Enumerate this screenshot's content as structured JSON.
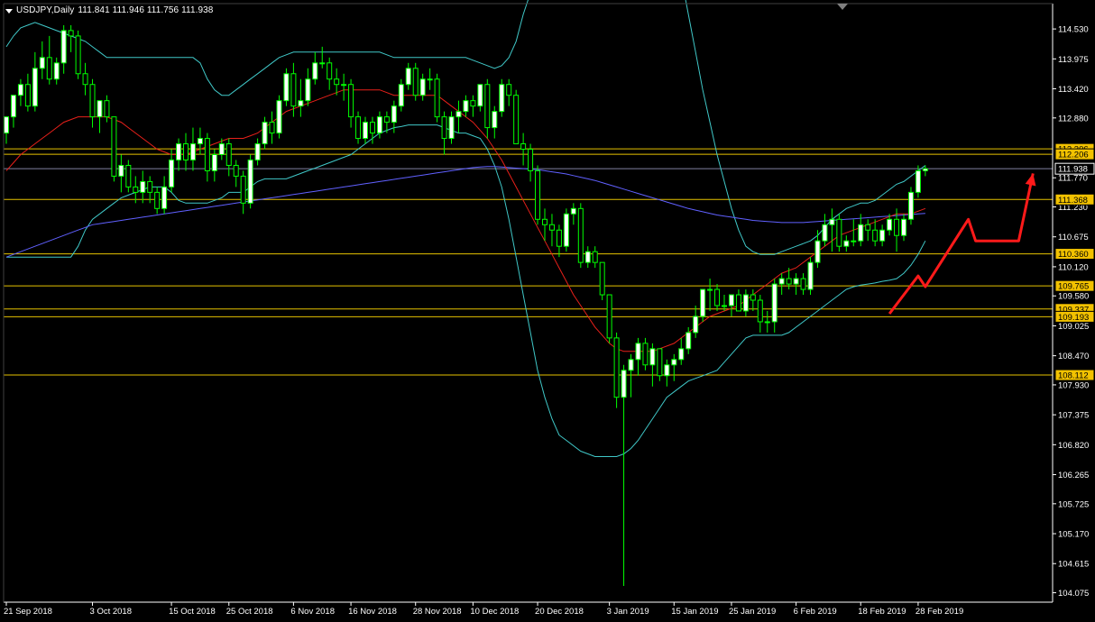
{
  "header": {
    "symbol": "USDJPY,Daily",
    "quote": "111.841 111.946 111.756 111.938"
  },
  "colors": {
    "background": "#000000",
    "axis": "#ffffff",
    "bull_candle": "#ffffff",
    "candle_outline": "#00ff00",
    "bollinger_band": "#40c8c8",
    "ma_fast": "#e8201a",
    "ma_slow": "#6060ff",
    "level_line": "#e6c200",
    "level_label_bg": "#f2c200",
    "current_price_bg": "#000000",
    "arrow": "#ff1a1a"
  },
  "chart_data": {
    "type": "candlestick",
    "title": "USDJPY,Daily",
    "ylim": [
      103.9,
      115.0
    ],
    "y_ticks": [
      "114.530",
      "113.975",
      "113.420",
      "112.880",
      "111.770",
      "111.230",
      "110.675",
      "110.120",
      "109.580",
      "109.025",
      "108.470",
      "107.930",
      "107.375",
      "106.820",
      "106.265",
      "105.725",
      "105.170",
      "104.615",
      "104.075"
    ],
    "x_ticks": [
      "21 Sep 2018",
      "3 Oct 2018",
      "15 Oct 2018",
      "25 Oct 2018",
      "6 Nov 2018",
      "16 Nov 2018",
      "28 Nov 2018",
      "10 Dec 2018",
      "20 Dec 2018",
      "3 Jan 2019",
      "15 Jan 2019",
      "25 Jan 2019",
      "6 Feb 2019",
      "18 Feb 2019",
      "28 Feb 2019"
    ],
    "x_tick_index": [
      0,
      12,
      23,
      31,
      40,
      48,
      57,
      65,
      74,
      84,
      93,
      101,
      110,
      119,
      127
    ],
    "levels": [
      "112.306",
      "112.206",
      "111.368",
      "110.360",
      "109.765",
      "109.337",
      "109.193",
      "108.112"
    ],
    "current_price": "111.938",
    "candles": {
      "open": [
        112.6,
        112.9,
        113.3,
        113.5,
        113.1,
        113.8,
        114.0,
        113.6,
        113.9,
        114.5,
        114.4,
        113.7,
        113.5,
        112.9,
        113.2,
        112.9,
        111.8,
        112.0,
        111.6,
        111.5,
        111.7,
        111.5,
        111.2,
        111.6,
        112.1,
        112.4,
        112.1,
        112.4,
        112.5,
        111.9,
        112.2,
        112.4,
        112.0,
        111.8,
        111.3,
        112.1,
        112.4,
        112.8,
        112.6,
        113.2,
        113.7,
        113.1,
        113.2,
        113.6,
        113.9,
        113.9,
        113.6,
        113.5,
        113.5,
        112.9,
        112.5,
        112.8,
        112.6,
        112.9,
        112.8,
        113.1,
        113.5,
        113.8,
        113.3,
        113.6,
        113.6,
        112.9,
        112.5,
        112.9,
        113.0,
        113.2,
        113.1,
        113.5,
        112.7,
        113.0,
        113.5,
        113.3,
        112.4,
        112.3,
        111.9,
        111.0,
        110.9,
        110.8,
        110.5,
        111.1,
        111.2,
        110.2,
        110.4,
        110.2,
        109.6,
        108.8,
        107.7,
        108.2,
        108.4,
        108.7,
        108.3,
        108.6,
        108.1,
        108.3,
        108.4,
        108.6,
        108.9,
        109.2,
        109.7,
        109.7,
        109.4,
        109.4,
        109.6,
        109.3,
        109.6,
        109.5,
        109.1,
        109.1,
        109.8,
        109.9,
        109.8,
        109.9,
        109.7,
        110.2,
        110.6,
        110.9,
        111.0,
        110.5,
        110.6,
        110.6,
        110.9,
        110.8,
        110.6,
        110.8,
        111.0,
        110.7,
        111.0,
        111.5,
        111.9
      ],
      "high": [
        112.9,
        113.3,
        113.6,
        113.7,
        114.1,
        114.3,
        114.4,
        114.0,
        114.6,
        114.6,
        114.5,
        113.9,
        113.6,
        113.1,
        113.3,
        112.9,
        112.2,
        112.1,
        111.8,
        111.9,
        111.8,
        111.6,
        111.8,
        112.3,
        112.5,
        112.6,
        112.7,
        112.7,
        112.6,
        112.3,
        112.5,
        112.5,
        112.1,
        111.9,
        112.2,
        112.5,
        112.9,
        113.0,
        113.3,
        113.8,
        113.9,
        113.6,
        113.8,
        114.1,
        114.2,
        114.0,
        113.8,
        113.7,
        113.6,
        113.0,
        112.9,
        112.9,
        113.0,
        113.0,
        113.2,
        113.6,
        113.9,
        113.9,
        113.7,
        113.8,
        113.7,
        113.0,
        113.0,
        113.2,
        113.3,
        113.3,
        113.5,
        113.6,
        113.1,
        113.6,
        113.6,
        113.4,
        112.6,
        112.4,
        112.0,
        111.2,
        111.1,
        110.9,
        111.2,
        111.3,
        111.3,
        110.5,
        110.5,
        110.2,
        109.6,
        108.9,
        108.3,
        108.5,
        108.8,
        108.8,
        108.7,
        108.6,
        108.4,
        108.5,
        108.8,
        109.0,
        109.4,
        109.7,
        109.9,
        109.8,
        109.6,
        109.6,
        109.7,
        109.7,
        109.7,
        109.6,
        109.3,
        109.9,
        110.0,
        110.1,
        110.0,
        110.0,
        110.3,
        110.8,
        111.1,
        111.2,
        111.1,
        110.7,
        111.0,
        111.1,
        111.0,
        111.0,
        110.9,
        111.1,
        111.2,
        111.1,
        111.6,
        112.0,
        112.0
      ],
      "low": [
        112.4,
        112.7,
        113.1,
        113.0,
        113.0,
        113.6,
        113.5,
        113.5,
        113.7,
        114.1,
        113.6,
        113.3,
        112.7,
        112.6,
        112.8,
        111.7,
        111.5,
        111.5,
        111.3,
        111.3,
        111.3,
        111.1,
        111.1,
        111.5,
        111.9,
        111.9,
        111.9,
        112.2,
        111.7,
        111.7,
        112.1,
        111.8,
        111.6,
        111.1,
        111.2,
        112.0,
        112.3,
        112.4,
        112.5,
        113.1,
        112.9,
        112.9,
        113.1,
        113.5,
        113.8,
        113.4,
        113.3,
        113.2,
        112.7,
        112.4,
        112.4,
        112.4,
        112.5,
        112.6,
        112.6,
        113.0,
        113.4,
        113.2,
        113.2,
        113.4,
        112.8,
        112.2,
        112.4,
        112.6,
        112.9,
        112.9,
        113.0,
        112.5,
        112.5,
        112.9,
        113.1,
        112.4,
        112.0,
        111.7,
        110.9,
        110.6,
        110.5,
        110.3,
        110.4,
        110.9,
        110.1,
        110.1,
        110.1,
        109.5,
        108.7,
        107.5,
        104.2,
        107.7,
        108.1,
        108.2,
        107.9,
        108.0,
        107.9,
        108.0,
        108.3,
        108.5,
        108.8,
        109.1,
        109.3,
        109.3,
        109.3,
        109.2,
        109.3,
        109.2,
        109.3,
        108.9,
        108.9,
        108.9,
        109.6,
        109.7,
        109.6,
        109.6,
        109.6,
        110.1,
        110.5,
        110.4,
        110.4,
        110.4,
        110.5,
        110.5,
        110.6,
        110.5,
        110.5,
        110.7,
        110.4,
        110.6,
        110.9,
        111.4,
        111.8
      ],
      "close": [
        112.9,
        113.3,
        113.5,
        113.1,
        113.8,
        114.0,
        113.6,
        113.9,
        114.5,
        114.4,
        113.7,
        113.5,
        112.9,
        113.2,
        112.9,
        111.8,
        112.0,
        111.6,
        111.5,
        111.7,
        111.5,
        111.2,
        111.6,
        112.1,
        112.4,
        112.1,
        112.4,
        112.5,
        111.9,
        112.2,
        112.4,
        112.0,
        111.8,
        111.3,
        112.1,
        112.4,
        112.8,
        112.6,
        113.2,
        113.7,
        113.1,
        113.2,
        113.6,
        113.9,
        113.9,
        113.6,
        113.5,
        113.5,
        112.9,
        112.5,
        112.8,
        112.6,
        112.9,
        112.8,
        113.1,
        113.5,
        113.8,
        113.3,
        113.6,
        113.6,
        112.9,
        112.5,
        112.9,
        113.0,
        113.2,
        113.1,
        113.5,
        112.7,
        113.0,
        113.5,
        113.3,
        112.4,
        112.3,
        111.9,
        111.0,
        110.9,
        110.8,
        110.5,
        111.1,
        111.2,
        110.2,
        110.4,
        110.2,
        109.6,
        108.8,
        107.7,
        108.2,
        108.4,
        108.7,
        108.3,
        108.6,
        108.1,
        108.3,
        108.4,
        108.6,
        108.9,
        109.2,
        109.7,
        109.7,
        109.4,
        109.4,
        109.6,
        109.3,
        109.6,
        109.5,
        109.1,
        109.1,
        109.8,
        109.9,
        109.8,
        109.9,
        109.7,
        110.2,
        110.6,
        110.9,
        111.0,
        110.5,
        110.6,
        110.6,
        110.9,
        110.8,
        110.6,
        110.8,
        111.0,
        110.7,
        111.0,
        111.5,
        111.9,
        111.938
      ]
    },
    "ma_fast": [
      111.9,
      112.05,
      112.2,
      112.3,
      112.4,
      112.5,
      112.6,
      112.7,
      112.8,
      112.85,
      112.9,
      112.9,
      112.9,
      112.9,
      112.9,
      112.85,
      112.8,
      112.7,
      112.6,
      112.5,
      112.4,
      112.3,
      112.25,
      112.2,
      112.2,
      112.2,
      112.25,
      112.3,
      112.35,
      112.4,
      112.45,
      112.5,
      112.5,
      112.5,
      112.55,
      112.6,
      112.7,
      112.8,
      112.9,
      113.0,
      113.05,
      113.1,
      113.15,
      113.2,
      113.25,
      113.3,
      113.35,
      113.4,
      113.4,
      113.4,
      113.4,
      113.4,
      113.4,
      113.35,
      113.3,
      113.3,
      113.3,
      113.3,
      113.3,
      113.3,
      113.3,
      113.2,
      113.1,
      113.0,
      112.9,
      112.8,
      112.65,
      112.5,
      112.3,
      112.1,
      111.85,
      111.6,
      111.35,
      111.1,
      110.85,
      110.6,
      110.35,
      110.1,
      109.85,
      109.6,
      109.4,
      109.2,
      109.0,
      108.85,
      108.7,
      108.6,
      108.55,
      108.55,
      108.55,
      108.55,
      108.55,
      108.6,
      108.65,
      108.7,
      108.8,
      108.9,
      109.0,
      109.1,
      109.2,
      109.25,
      109.3,
      109.35,
      109.4,
      109.5,
      109.6,
      109.7,
      109.8,
      109.9,
      110.0,
      110.05,
      110.1,
      110.2,
      110.3,
      110.4,
      110.5,
      110.6,
      110.7,
      110.75,
      110.8,
      110.85,
      110.9,
      110.95,
      111.0,
      111.05,
      111.1,
      111.1,
      111.1,
      111.15,
      111.2
    ],
    "ma_slow": [
      110.3,
      110.35,
      110.4,
      110.45,
      110.5,
      110.55,
      110.6,
      110.65,
      110.7,
      110.75,
      110.8,
      110.85,
      110.9,
      110.92,
      110.94,
      110.96,
      110.98,
      111.0,
      111.02,
      111.04,
      111.06,
      111.08,
      111.1,
      111.12,
      111.14,
      111.16,
      111.18,
      111.2,
      111.22,
      111.24,
      111.26,
      111.28,
      111.3,
      111.32,
      111.34,
      111.36,
      111.38,
      111.4,
      111.42,
      111.44,
      111.46,
      111.48,
      111.5,
      111.52,
      111.54,
      111.56,
      111.58,
      111.6,
      111.62,
      111.64,
      111.66,
      111.68,
      111.7,
      111.72,
      111.74,
      111.76,
      111.78,
      111.8,
      111.82,
      111.84,
      111.86,
      111.88,
      111.9,
      111.92,
      111.94,
      111.96,
      111.97,
      111.98,
      111.98,
      111.97,
      111.96,
      111.95,
      111.94,
      111.93,
      111.92,
      111.9,
      111.88,
      111.86,
      111.84,
      111.81,
      111.78,
      111.75,
      111.72,
      111.68,
      111.64,
      111.6,
      111.56,
      111.52,
      111.48,
      111.44,
      111.4,
      111.36,
      111.32,
      111.28,
      111.24,
      111.2,
      111.17,
      111.14,
      111.11,
      111.08,
      111.06,
      111.04,
      111.02,
      111.0,
      110.98,
      110.97,
      110.96,
      110.95,
      110.94,
      110.94,
      110.94,
      110.94,
      110.95,
      110.96,
      110.97,
      110.98,
      110.99,
      111.0,
      111.01,
      111.02,
      111.03,
      111.04,
      111.05,
      111.06,
      111.07,
      111.08,
      111.09,
      111.1,
      111.11
    ],
    "bb_upper": [
      114.2,
      114.4,
      114.55,
      114.6,
      114.65,
      114.6,
      114.55,
      114.5,
      114.45,
      114.4,
      114.35,
      114.3,
      114.2,
      114.1,
      114.0,
      114.0,
      114.0,
      114.0,
      114.0,
      114.0,
      114.0,
      114.0,
      114.0,
      114.0,
      114.0,
      114.0,
      114.0,
      113.9,
      113.6,
      113.4,
      113.3,
      113.3,
      113.4,
      113.5,
      113.6,
      113.7,
      113.8,
      113.9,
      114.0,
      114.05,
      114.1,
      114.1,
      114.1,
      114.1,
      114.1,
      114.1,
      114.1,
      114.1,
      114.1,
      114.1,
      114.1,
      114.1,
      114.1,
      114.05,
      114.0,
      114.0,
      114.0,
      114.0,
      114.0,
      114.0,
      114.0,
      114.0,
      114.0,
      114.0,
      114.0,
      113.95,
      113.9,
      113.85,
      113.8,
      113.85,
      114.0,
      114.3,
      114.8,
      115.2,
      115.6,
      115.9,
      116.1,
      116.3,
      116.5,
      116.7,
      116.9,
      117.1,
      117.3,
      117.5,
      117.6,
      117.6,
      117.6,
      117.55,
      117.5,
      117.4,
      117.2,
      117.0,
      116.6,
      116.1,
      115.5,
      114.8,
      114.1,
      113.4,
      112.8,
      112.2,
      111.7,
      111.2,
      110.8,
      110.5,
      110.4,
      110.35,
      110.35,
      110.35,
      110.4,
      110.45,
      110.5,
      110.55,
      110.6,
      110.7,
      110.85,
      111.0,
      111.1,
      111.2,
      111.25,
      111.3,
      111.3,
      111.35,
      111.45,
      111.55,
      111.65,
      111.7,
      111.8,
      111.9,
      112.0
    ],
    "bb_lower": [
      110.3,
      110.3,
      110.3,
      110.3,
      110.3,
      110.3,
      110.3,
      110.3,
      110.3,
      110.3,
      110.5,
      110.8,
      111.0,
      111.1,
      111.2,
      111.3,
      111.4,
      111.45,
      111.5,
      111.55,
      111.6,
      111.6,
      111.6,
      111.5,
      111.35,
      111.3,
      111.3,
      111.3,
      111.3,
      111.35,
      111.4,
      111.5,
      111.5,
      111.5,
      111.6,
      111.7,
      111.75,
      111.75,
      111.75,
      111.75,
      111.8,
      111.85,
      111.9,
      111.95,
      112.0,
      112.05,
      112.1,
      112.15,
      112.2,
      112.3,
      112.4,
      112.5,
      112.6,
      112.65,
      112.7,
      112.72,
      112.75,
      112.75,
      112.75,
      112.75,
      112.75,
      112.7,
      112.65,
      112.6,
      112.6,
      112.55,
      112.5,
      112.3,
      112.0,
      111.6,
      111.0,
      110.3,
      109.6,
      108.9,
      108.2,
      107.7,
      107.3,
      107.0,
      106.9,
      106.8,
      106.7,
      106.65,
      106.6,
      106.6,
      106.6,
      106.6,
      106.65,
      106.75,
      106.9,
      107.1,
      107.3,
      107.5,
      107.7,
      107.8,
      107.9,
      108.0,
      108.05,
      108.1,
      108.15,
      108.2,
      108.35,
      108.5,
      108.65,
      108.8,
      108.85,
      108.85,
      108.85,
      108.85,
      108.85,
      108.9,
      109.0,
      109.1,
      109.2,
      109.3,
      109.4,
      109.5,
      109.6,
      109.7,
      109.75,
      109.78,
      109.8,
      109.82,
      109.85,
      109.87,
      109.9,
      110.0,
      110.15,
      110.35,
      110.6
    ],
    "arrow_path": [
      [
        123,
        109.25
      ],
      [
        127,
        109.95
      ],
      [
        128,
        109.75
      ],
      [
        134,
        111.0
      ],
      [
        135,
        110.6
      ],
      [
        141,
        110.6
      ],
      [
        143,
        111.85
      ]
    ]
  }
}
